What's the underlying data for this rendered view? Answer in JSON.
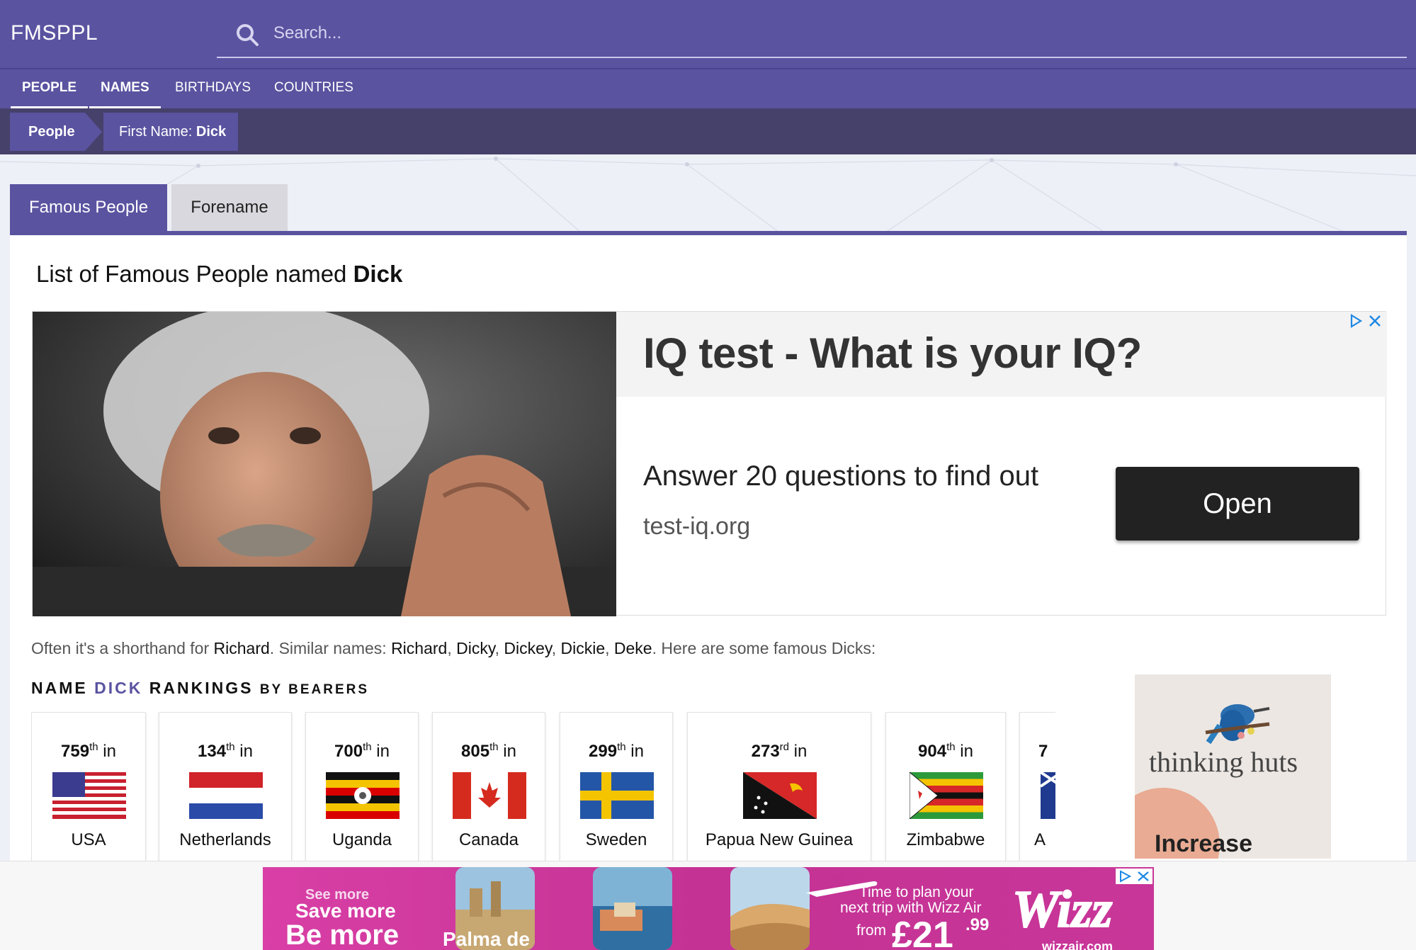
{
  "header": {
    "logo": "FMSPPL",
    "search_placeholder": "Search..."
  },
  "nav": [
    "PEOPLE",
    "NAMES",
    "BIRTHDAYS",
    "COUNTRIES"
  ],
  "breadcrumb": {
    "root": "People",
    "current_prefix": "First Name: ",
    "current_name": "Dick"
  },
  "tabs": [
    "Famous People",
    "Forename"
  ],
  "heading": {
    "prefix": "List of Famous People named ",
    "name": "Dick"
  },
  "ad": {
    "title": "IQ test - What is your IQ?",
    "subtitle": "Answer 20 questions to find out",
    "domain": "test-iq.org",
    "button": "Open"
  },
  "description": {
    "p1": "Often it's a shorthand for ",
    "n1": "Richard",
    "p2": ". Similar names: ",
    "n2": "Richard",
    "n3": "Dicky",
    "n4": "Dickey",
    "n5": "Dickie",
    "n6": "Deke",
    "sep": ", ",
    "p3": ". Here are some famous Dicks:"
  },
  "rankings": {
    "title_a": "NAME ",
    "title_name": "DICK",
    "title_b": " RANKINGS ",
    "title_by": "BY BEARERS",
    "in_label": " in",
    "items": [
      {
        "rank": "759",
        "suffix": "th",
        "country": "USA"
      },
      {
        "rank": "134",
        "suffix": "th",
        "country": "Netherlands"
      },
      {
        "rank": "700",
        "suffix": "th",
        "country": "Uganda"
      },
      {
        "rank": "805",
        "suffix": "th",
        "country": "Canada"
      },
      {
        "rank": "299",
        "suffix": "th",
        "country": "Sweden"
      },
      {
        "rank": "273",
        "suffix": "rd",
        "country": "Papua New Guinea"
      },
      {
        "rank": "904",
        "suffix": "th",
        "country": "Zimbabwe"
      },
      {
        "rank": "7",
        "suffix": "",
        "country": "A"
      }
    ]
  },
  "side_ad": {
    "brand": "thinking huts",
    "cta": "Increase"
  },
  "bottom_ad": {
    "l1": "See more",
    "l2": "Save more",
    "l3": "Be more",
    "city": "Palma de",
    "t1": "Time to plan your",
    "t2": "next trip with Wizz Air",
    "from": "from",
    "price": "£21",
    "cents": ".99",
    "logo": "Wizz",
    "site": "wizzair.com"
  },
  "colors": {
    "brand": "#5a53a0",
    "breadcrumb_bar": "#46416a",
    "ad_pink": "#d93fa6"
  }
}
